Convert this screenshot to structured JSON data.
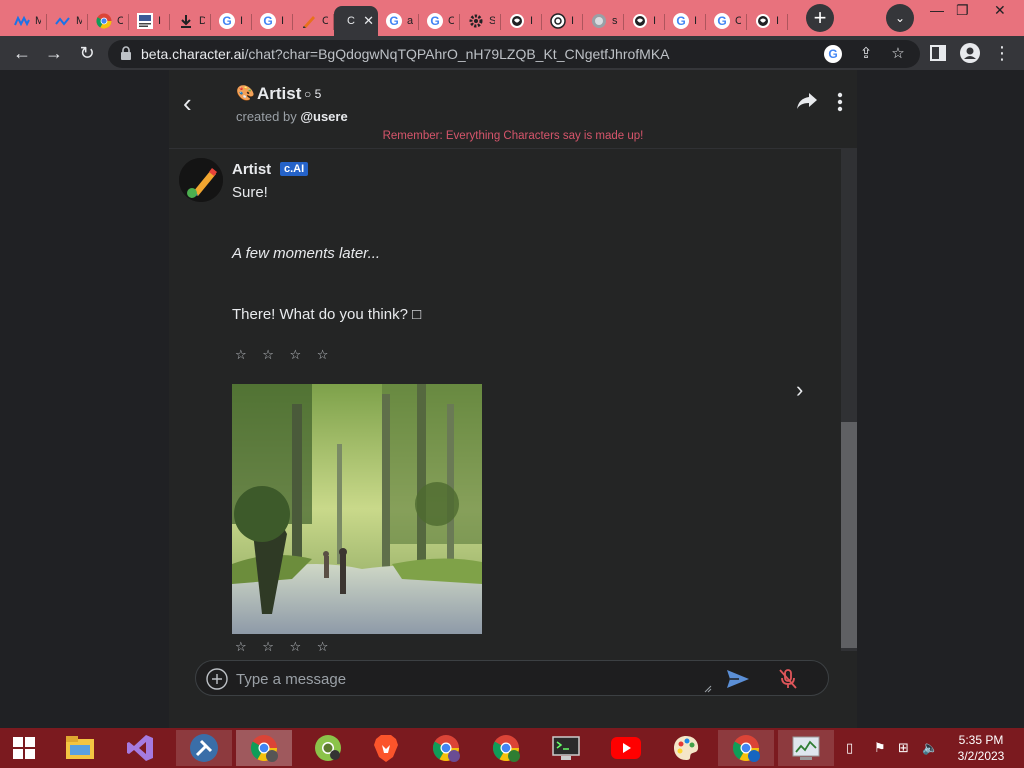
{
  "browser": {
    "tabs": [
      {
        "icon": "m-logo-icon",
        "title": "M"
      },
      {
        "icon": "m-logo-icon",
        "title": "M"
      },
      {
        "icon": "chrome-icon",
        "title": "C"
      },
      {
        "icon": "news-icon",
        "title": "I"
      },
      {
        "icon": "download-icon",
        "title": "D"
      },
      {
        "icon": "google-icon",
        "title": "I"
      },
      {
        "icon": "google-icon",
        "title": "I"
      },
      {
        "icon": "pencil-icon",
        "title": "C"
      },
      {
        "icon": "character-icon",
        "title": "C",
        "active": true
      },
      {
        "icon": "google-icon",
        "title": "a"
      },
      {
        "icon": "google-icon",
        "title": "C"
      },
      {
        "icon": "gear-icon",
        "title": "S"
      },
      {
        "icon": "globe-icon",
        "title": "I"
      },
      {
        "icon": "chrome-icon",
        "title": "I"
      },
      {
        "icon": "globe-icon",
        "title": "s"
      },
      {
        "icon": "globe-icon",
        "title": "I"
      },
      {
        "icon": "google-icon",
        "title": "I"
      },
      {
        "icon": "google-icon",
        "title": "C"
      },
      {
        "icon": "globe-icon",
        "title": "I"
      }
    ],
    "url_host": "beta.character.ai",
    "url_path": "/chat?char=BgQdogwNqTQPAhrO_nH79LZQB_Kt_CNgetfJhrofMKA"
  },
  "chat": {
    "character_name": "Artist",
    "chat_count": "5",
    "created_by_label": "created by",
    "creator": "@usere",
    "reminder": "Remember: Everything Characters say is made up!",
    "message": {
      "author": "Artist",
      "badge": "c.AI",
      "line1": "Sure!",
      "line2": "A few moments later...",
      "line3": "There! What do you think? □",
      "rating_stars": "☆ ☆ ☆ ☆",
      "rating_stars_bottom": "☆ ☆ ☆ ☆"
    },
    "composer": {
      "placeholder": "Type a message"
    }
  },
  "taskbar": {
    "apps": [
      "start-icon",
      "file-explorer-icon",
      "visual-studio-icon",
      "tools-icon",
      "chrome-profile-icon",
      "chromium-icon",
      "brave-icon",
      "chrome-profile-icon",
      "chrome-profile-icon",
      "terminal-icon",
      "youtube-icon",
      "paint-icon",
      "chrome-profile-icon",
      "task-manager-icon"
    ],
    "time": "5:35 PM",
    "date": "3/2/2023"
  },
  "colors": {
    "tab_strip": "#e8727d",
    "toolbar": "#35363a",
    "page_bg": "#202124",
    "panel_bg": "#242525",
    "reminder": "#d6556b",
    "badge": "#2563c9",
    "send": "#5b8fd6",
    "mic_muted": "#e0565a",
    "taskbar": "#7b1a1f"
  }
}
